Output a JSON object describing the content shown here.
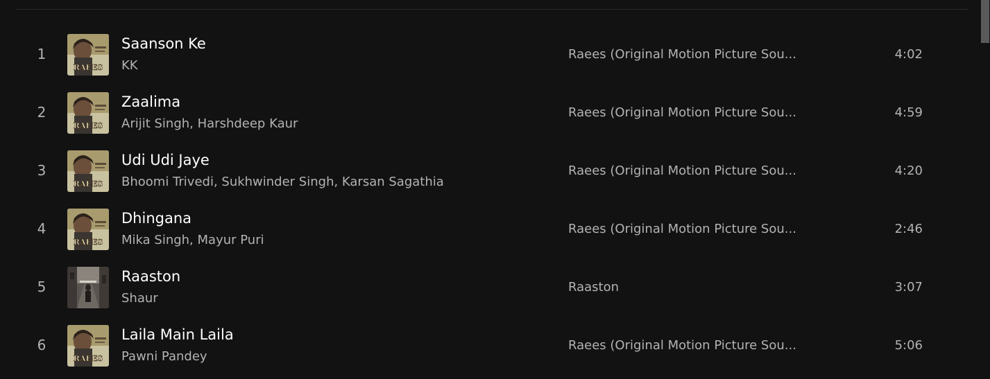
{
  "tracks": [
    {
      "number": "1",
      "title": "Saanson Ke",
      "artists": "KK",
      "album": "Raees (Original Motion Picture Sou...",
      "duration": "4:02",
      "cover": "raees"
    },
    {
      "number": "2",
      "title": "Zaalima",
      "artists": "Arijit Singh, Harshdeep Kaur",
      "album": "Raees (Original Motion Picture Sou...",
      "duration": "4:59",
      "cover": "raees"
    },
    {
      "number": "3",
      "title": "Udi Udi Jaye",
      "artists": "Bhoomi Trivedi, Sukhwinder Singh, Karsan Sagathia",
      "album": "Raees (Original Motion Picture Sou...",
      "duration": "4:20",
      "cover": "raees"
    },
    {
      "number": "4",
      "title": "Dhingana",
      "artists": "Mika Singh, Mayur Puri",
      "album": "Raees (Original Motion Picture Sou...",
      "duration": "2:46",
      "cover": "raees"
    },
    {
      "number": "5",
      "title": "Raaston",
      "artists": "Shaur",
      "album": "Raaston",
      "duration": "3:07",
      "cover": "raaston"
    },
    {
      "number": "6",
      "title": "Laila Main Laila",
      "artists": "Pawni Pandey",
      "album": "Raees (Original Motion Picture Sou...",
      "duration": "5:06",
      "cover": "raees"
    }
  ],
  "colors": {
    "background": "#121212",
    "primary_text": "#ffffff",
    "secondary_text": "#b3b3b3"
  }
}
